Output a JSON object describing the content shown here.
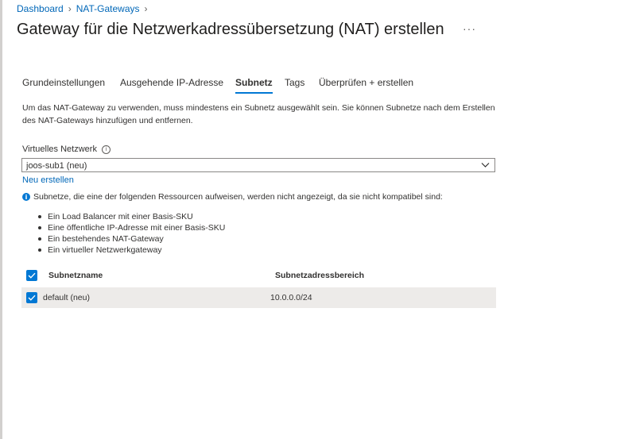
{
  "breadcrumb": [
    "Dashboard",
    "NAT-Gateways"
  ],
  "title": "Gateway für die Netzwerkadressübersetzung (NAT) erstellen",
  "more_label": "···",
  "tabs": [
    {
      "label": "Grundeinstellungen"
    },
    {
      "label": "Ausgehende IP-Adresse"
    },
    {
      "label": "Subnetz"
    },
    {
      "label": "Tags"
    },
    {
      "label": "Überprüfen + erstellen"
    }
  ],
  "active_tab": "Subnetz",
  "description_line1": "Um das NAT-Gateway zu verwenden, muss mindestens ein Subnetz ausgewählt sein. Sie können Subnetze nach dem Erstellen",
  "description_line2": "des NAT-Gateways hinzufügen und entfernen.",
  "vnet": {
    "label": "Virtuelles Netzwerk",
    "value": "joos-sub1 (neu)",
    "create_new": "Neu erstellen"
  },
  "notice": {
    "icon": "info-icon",
    "text": "Subnetze, die eine der folgenden Ressourcen aufweisen, werden nicht angezeigt, da sie nicht kompatibel sind:",
    "items": [
      "Ein Load Balancer mit einer Basis-SKU",
      "Eine öffentliche IP-Adresse mit einer Basis-SKU",
      "Ein bestehendes NAT-Gateway",
      "Ein virtueller Netzwerkgateway"
    ]
  },
  "table": {
    "columns": [
      "Subnetzname",
      "Subnetzadressbereich"
    ],
    "rows": [
      {
        "name": "default (neu)",
        "range": "10.0.0.0/24",
        "checked": true
      }
    ],
    "select_all_checked": true
  },
  "colors": {
    "accent": "#0078d4",
    "link": "#0067b8",
    "row_bg": "#edebe9"
  }
}
